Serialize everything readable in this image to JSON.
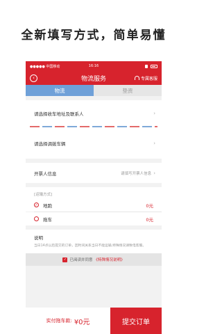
{
  "headline": "全新填写方式，简单易懂",
  "status_bar": {
    "carrier": "●●●●● 中国移动",
    "time": "16:16"
  },
  "navbar": {
    "title": "物流服务",
    "service": "专属客服"
  },
  "tabs": [
    {
      "label": "物流",
      "active": true
    },
    {
      "label": "垫资",
      "active": false
    }
  ],
  "rows": {
    "address": "请选择收车地址及联系人",
    "vehicle": "请选择调拨车辆",
    "invoice_label": "开票人信息",
    "invoice_placeholder": "请填写开票人信息"
  },
  "transport": {
    "label": "[运输方式]",
    "options": [
      {
        "label": "地跑",
        "price": "0元",
        "selected": true
      },
      {
        "label": "拖车",
        "price": "0元",
        "selected": false
      }
    ]
  },
  "note": {
    "title": "说明",
    "text": "当日14点以后提交的订单，因时间关系当日不能运输,特殊情况请致电客服。"
  },
  "agreement": {
    "text": "已阅读并同意",
    "link": "《特殊情况说明》"
  },
  "footer": {
    "total_label": "实付拖车款:",
    "total_amount": "¥0元",
    "submit": "提交订单"
  },
  "colors": {
    "brand": "#d7232d",
    "tab_active": "#6fa0d8"
  }
}
